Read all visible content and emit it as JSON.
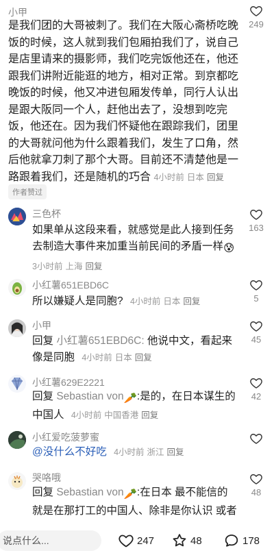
{
  "main_comment": {
    "author": "小甲",
    "text": "是我们团的大哥被刺了。我们在大阪心斋桥吃晚饭的时候，这人就到我们包厢拍我们了，说自己是店里请来的摄影师，我们吃完饭他还在，他还跟我们讲附近能逛的地方，相对正常。到京都吃晚饭的时候，他又冲进包厢发传单，同行人认出是跟大阪同一个人，赶他出去了，没想到吃完饭，他还在。因为我们怀疑他在跟踪我们，团里的大哥就问他为什么跟着我们，发生了口角，然后他就拿刀刺了那个大哥。目前还不清楚他是一路跟着我们，还是随机的巧合",
    "time": "4小时前",
    "location": "日本",
    "reply_label": "回复",
    "likes": "249",
    "badge": "作者赞过"
  },
  "replies": [
    {
      "author": "三色杯",
      "text": "如果单从这段来看，就感觉是此人接到任务去制造大事件来加重当前民间的矛盾一样",
      "emoji": "😰",
      "time": "3小时前",
      "location": "上海",
      "reply_label": "回复",
      "likes": "163"
    },
    {
      "author": "小红薯651EBD6C",
      "text": "所以嫌疑人是同胞?",
      "time": "4小时前",
      "location": "日本",
      "reply_label": "回复",
      "likes": "5"
    },
    {
      "author": "小甲",
      "prefix": "回复",
      "target": "小红薯651EBD6C:",
      "text": "他说中文，看起来像是同胞",
      "time": "4小时前",
      "location": "日本",
      "reply_label": "回复",
      "likes": "45"
    },
    {
      "author": "小红薯629E2221",
      "prefix": "回复",
      "target": "Sebastian von",
      "target_emoji": "🥕",
      "text": ":是的，在日本谋生的中国人",
      "time": "4小时前",
      "location": "中国香港",
      "reply_label": "回复",
      "likes": "42"
    },
    {
      "author": "小红爱吃菠萝蜜",
      "mention": "@没什么不好吃",
      "time": "4小时前",
      "location": "浙江",
      "reply_label": "回复",
      "likes": ""
    },
    {
      "author": "哭咯哦",
      "prefix": "回复",
      "target": "Sebastian von",
      "target_emoji": "🥕",
      "text": ":在日本 最不能信的就是在那打工的中国人、除非是你认识 或者",
      "likes": "48"
    }
  ],
  "bottom_bar": {
    "input_placeholder": "说点什么...",
    "likes": "247",
    "favorites": "48",
    "comments": "178"
  },
  "colors": {
    "text": "#222222",
    "meta": "#999999",
    "mention": "#2b5fb8"
  }
}
